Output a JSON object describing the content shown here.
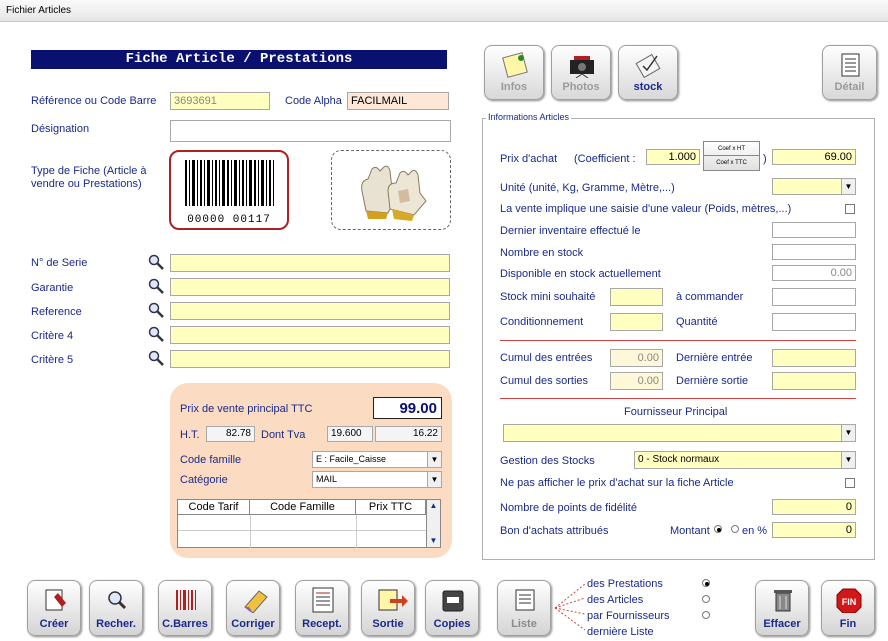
{
  "window": {
    "title": "Fichier Articles"
  },
  "header": {
    "title": "Fiche Article / Prestations"
  },
  "identity": {
    "reference_label": "Référence ou Code Barre",
    "reference_value": "3693691",
    "code_alpha_label": "Code Alpha",
    "code_alpha_value": "FACILMAIL",
    "designation_label": "Désignation",
    "designation_value": "",
    "type_label": "Type de Fiche (Article à vendre ou Prestations)",
    "barcode_text": "00000 00117"
  },
  "search_fields": [
    {
      "label": "N° de Serie",
      "value": ""
    },
    {
      "label": "Garantie",
      "value": ""
    },
    {
      "label": "Reference",
      "value": ""
    },
    {
      "label": "Critère 4",
      "value": ""
    },
    {
      "label": "Critère 5",
      "value": ""
    }
  ],
  "pricing": {
    "main_price_label": "Prix de vente principal TTC",
    "main_price_value": "99.00",
    "ht_label": "H.T.",
    "ht_value": "82.78",
    "tva_label": "Dont Tva",
    "tva_rate": "19.600",
    "tva_amount": "16.22",
    "code_famille_label": "Code famille",
    "code_famille_value": "E : Facile_Caisse",
    "categorie_label": "Catégorie",
    "categorie_value": "MAIL",
    "tarif_columns": [
      "Code Tarif",
      "Code Famille",
      "Prix TTC"
    ]
  },
  "top_buttons": {
    "infos": "Infos",
    "photos": "Photos",
    "stock": "stock",
    "detail": "Détail"
  },
  "info": {
    "group_title": "Informations Articles",
    "prix_achat_label": "Prix d'achat",
    "coefficient_label": "(Coefficient :",
    "coefficient_value": "1.000",
    "coef_ht": "Coef x HT",
    "coef_ttc": "Coef x TTC",
    "close_paren": ")",
    "prix_achat_value": "69.00",
    "unite_label": "Unité (unité, Kg, Gramme, Mètre,...)",
    "unite_value": "",
    "saisie_label": "La vente implique une saisie d'une valeur (Poids, mètres,...)",
    "inventaire_label": "Dernier inventaire effectué le",
    "nombre_stock_label": "Nombre en stock",
    "disponible_label": "Disponible en stock actuellement",
    "disponible_value": "0.00",
    "stock_mini_label": "Stock mini souhaité",
    "a_commander_label": "à commander",
    "conditionnement_label": "Conditionnement",
    "quantite_label": "Quantité",
    "cumul_entrees_label": "Cumul des entrées",
    "cumul_entrees_value": "0.00",
    "derniere_entree_label": "Dernière entrée",
    "cumul_sorties_label": "Cumul des sorties",
    "cumul_sorties_value": "0.00",
    "derniere_sortie_label": "Dernière sortie",
    "fournisseur_label": "Fournisseur Principal",
    "fournisseur_value": "",
    "gestion_label": "Gestion des Stocks",
    "gestion_value": "0 - Stock normaux",
    "ne_pas_afficher_label": "Ne pas afficher le prix d'achat sur la fiche Article",
    "points_label": "Nombre de points de fidélité",
    "points_value": "0",
    "bon_label": "Bon d'achats attribués",
    "montant_label": "Montant",
    "en_pct_label": "en %",
    "bon_value": "0"
  },
  "bottom_buttons": {
    "creer": "Créer",
    "recher": "Recher.",
    "cbarres": "C.Barres",
    "corriger": "Corriger",
    "recept": "Recept.",
    "sortie": "Sortie",
    "copies": "Copies",
    "liste": "Liste",
    "effacer": "Effacer",
    "fin": "Fin"
  },
  "liste_options": [
    {
      "label": "des Prestations",
      "selected": true
    },
    {
      "label": "des Articles",
      "selected": false
    },
    {
      "label": "par Fournisseurs",
      "selected": false
    },
    {
      "label": "dernière Liste",
      "selected": false
    }
  ],
  "colors": {
    "header": "#0a1070",
    "input_yellow": "#ffffc0",
    "panel_peach": "#fbdcc3",
    "barcode_border": "#b02020",
    "fin_red": "#d01818"
  }
}
